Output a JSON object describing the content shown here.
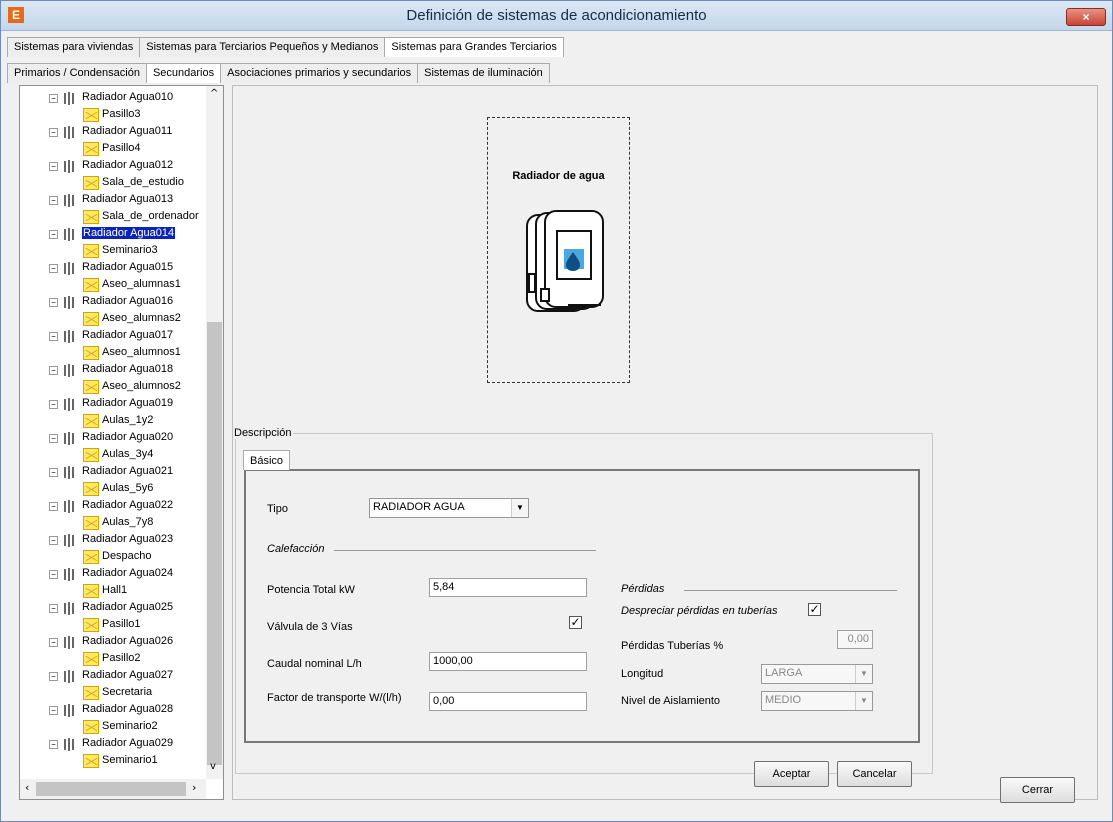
{
  "window": {
    "title": "Definición de sistemas de acondicionamiento"
  },
  "top_tabs": [
    "Sistemas para viviendas",
    "Sistemas para Terciarios Pequeños y Medianos",
    "Sistemas para Grandes Terciarios"
  ],
  "sub_tabs": [
    "Primarios / Condensación",
    "Secundarios",
    "Asociaciones primarios y secundarios",
    "Sistemas de iluminación"
  ],
  "tree": [
    {
      "name": "Radiador Agua010",
      "child": "Pasillo3"
    },
    {
      "name": "Radiador Agua011",
      "child": "Pasillo4"
    },
    {
      "name": "Radiador Agua012",
      "child": "Sala_de_estudio"
    },
    {
      "name": "Radiador Agua013",
      "child": "Sala_de_ordenador"
    },
    {
      "name": "Radiador Agua014",
      "child": "Seminario3",
      "selected": true
    },
    {
      "name": "Radiador Agua015",
      "child": "Aseo_alumnas1"
    },
    {
      "name": "Radiador Agua016",
      "child": "Aseo_alumnas2"
    },
    {
      "name": "Radiador Agua017",
      "child": "Aseo_alumnos1"
    },
    {
      "name": "Radiador Agua018",
      "child": "Aseo_alumnos2"
    },
    {
      "name": "Radiador Agua019",
      "child": "Aulas_1y2"
    },
    {
      "name": "Radiador Agua020",
      "child": "Aulas_3y4"
    },
    {
      "name": "Radiador Agua021",
      "child": "Aulas_5y6"
    },
    {
      "name": "Radiador Agua022",
      "child": "Aulas_7y8"
    },
    {
      "name": "Radiador Agua023",
      "child": "Despacho"
    },
    {
      "name": "Radiador Agua024",
      "child": "Hall1"
    },
    {
      "name": "Radiador Agua025",
      "child": "Pasillo1"
    },
    {
      "name": "Radiador Agua026",
      "child": "Pasillo2"
    },
    {
      "name": "Radiador Agua027",
      "child": "Secretaria"
    },
    {
      "name": "Radiador Agua028",
      "child": "Seminario2"
    },
    {
      "name": "Radiador Agua029",
      "child": "Seminario1"
    }
  ],
  "preview": {
    "title": "Radiador de agua"
  },
  "description": {
    "label": "Descripción",
    "tab": "Básico",
    "tipo_label": "Tipo",
    "tipo_value": "RADIADOR AGUA",
    "calefaccion": "Calefacción",
    "potencia_label": "Potencia Total kW",
    "potencia_value": "5,84",
    "valvula_label": "Válvula de 3 Vías",
    "caudal_label": "Caudal nominal L/h",
    "caudal_value": "1000,00",
    "factor_label": "Factor de transporte W/(l/h)",
    "factor_value": "0,00",
    "perdidas": "Pérdidas",
    "despreciar": "Despreciar pérdidas en tuberías",
    "perdidas_tuberias_label": "Pérdidas Tuberías %",
    "perdidas_tuberias_value": "0,00",
    "longitud_label": "Longitud",
    "longitud_value": "LARGA",
    "aislamiento_label": "Nivel de Aislamiento",
    "aislamiento_value": "MEDIO"
  },
  "buttons": {
    "accept": "Aceptar",
    "cancel": "Cancelar",
    "close": "Cerrar"
  }
}
